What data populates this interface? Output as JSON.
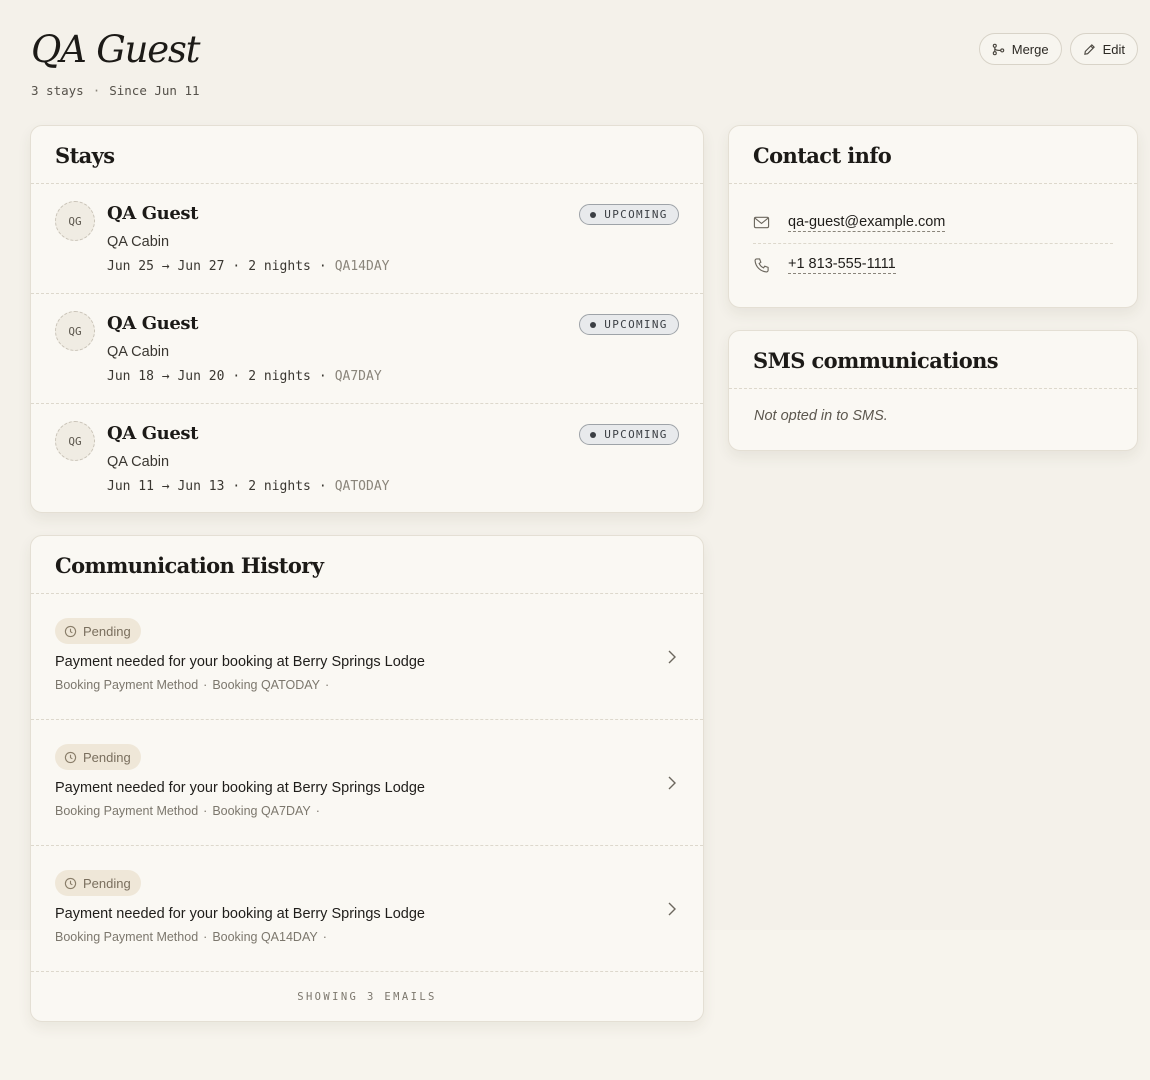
{
  "header": {
    "title": "QA Guest",
    "stays_count": "3 stays",
    "separator": "·",
    "since": "Since Jun 11",
    "merge_label": "Merge",
    "edit_label": "Edit"
  },
  "stays": {
    "title": "Stays",
    "items": [
      {
        "initials": "QG",
        "name": "QA Guest",
        "property": "QA Cabin",
        "dates": "Jun 25 → Jun 27",
        "nights": "2 nights",
        "code": "QA14DAY",
        "status": "UPCOMING"
      },
      {
        "initials": "QG",
        "name": "QA Guest",
        "property": "QA Cabin",
        "dates": "Jun 18 → Jun 20",
        "nights": "2 nights",
        "code": "QA7DAY",
        "status": "UPCOMING"
      },
      {
        "initials": "QG",
        "name": "QA Guest",
        "property": "QA Cabin",
        "dates": "Jun 11 → Jun 13",
        "nights": "2 nights",
        "code": "QATODAY",
        "status": "UPCOMING"
      }
    ]
  },
  "communication": {
    "title": "Communication History",
    "items": [
      {
        "status": "Pending",
        "subject": "Payment needed for your booking at Berry Springs Lodge",
        "type": "Booking Payment Method",
        "booking": "Booking QATODAY"
      },
      {
        "status": "Pending",
        "subject": "Payment needed for your booking at Berry Springs Lodge",
        "type": "Booking Payment Method",
        "booking": "Booking QA7DAY"
      },
      {
        "status": "Pending",
        "subject": "Payment needed for your booking at Berry Springs Lodge",
        "type": "Booking Payment Method",
        "booking": "Booking QA14DAY"
      }
    ],
    "footer": "SHOWING 3 EMAILS"
  },
  "contact": {
    "title": "Contact info",
    "email": "qa-guest@example.com",
    "phone": "+1 813-555-1111"
  },
  "sms": {
    "title": "SMS communications",
    "text": "Not opted in to SMS."
  },
  "icons": {
    "merge": "merge-icon",
    "edit": "pencil-icon",
    "email": "mail-icon",
    "phone": "phone-icon",
    "pending": "clock-icon",
    "row_arrow": "chevron-right-icon"
  }
}
